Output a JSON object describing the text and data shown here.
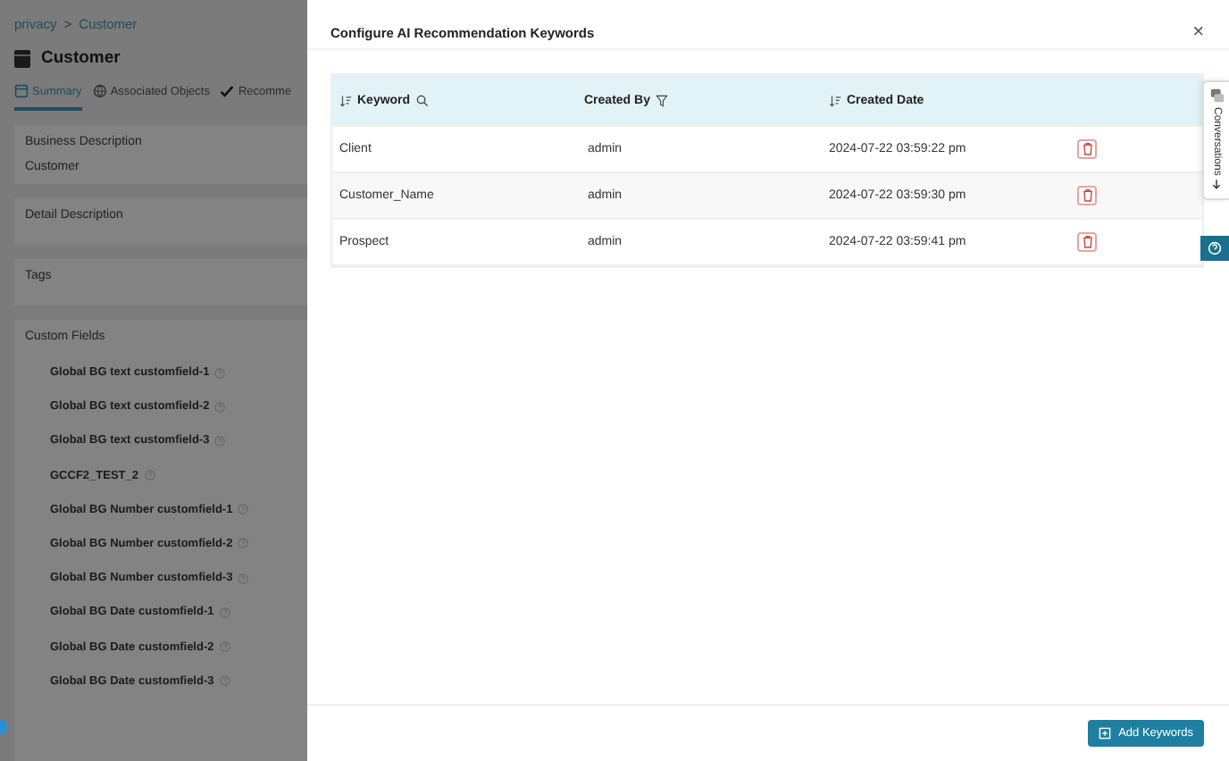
{
  "background_page": {
    "breadcrumb": [
      "privacy",
      "Customer"
    ],
    "breadcrumb_separator": ">",
    "title": "Customer",
    "tabs": [
      {
        "label": "Summary",
        "selected": true
      },
      {
        "label": "Associated Objects",
        "selected": false
      },
      {
        "label": "Recomme",
        "selected": false
      }
    ],
    "sections": [
      {
        "label": "Business Description",
        "value": "Customer"
      },
      {
        "label": "Detail Description"
      },
      {
        "label": "Tags"
      }
    ],
    "custom_fields": {
      "label": "Custom Fields",
      "items": [
        "Global BG text customfield-1",
        "Global BG text customfield-2",
        "Global BG text customfield-3",
        "GCCF2_TEST_2",
        "Global BG Number customfield-1",
        "Global BG Number customfield-2",
        "Global BG Number customfield-3",
        "Global BG Date customfield-1",
        "Global BG Date customfield-2",
        "Global BG Date customfield-3"
      ]
    }
  },
  "modal": {
    "title": "Configure AI Recommendation Keywords",
    "close": "×",
    "table": {
      "columns": [
        "Keyword",
        "Created By",
        "Created Date"
      ],
      "rows": [
        {
          "keyword": "Client",
          "created_by": "admin",
          "created_date": "2024-07-22 03:59:22 pm"
        },
        {
          "keyword": "Customer_Name",
          "created_by": "admin",
          "created_date": "2024-07-22 03:59:30 pm"
        },
        {
          "keyword": "Prospect",
          "created_by": "admin",
          "created_date": "2024-07-22 03:59:41 pm"
        }
      ]
    },
    "add_button": "Add Keywords"
  },
  "side_tab": {
    "label": "Conversations"
  }
}
